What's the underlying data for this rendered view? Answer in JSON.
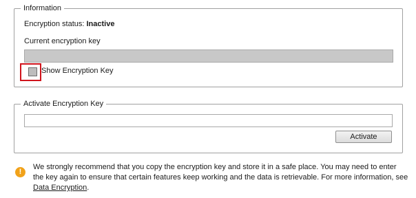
{
  "information": {
    "legend": "Information",
    "status_label": "Encryption status:",
    "status_value": "Inactive",
    "key_label": "Current encryption key",
    "key_value": "",
    "show_key_label": "Show Encryption Key",
    "show_key_checked": false
  },
  "activate": {
    "legend": "Activate Encryption Key",
    "input_value": "",
    "button_label": "Activate"
  },
  "notice": {
    "icon": "warning-icon",
    "text": "We strongly recommend that you copy the encryption key and store it in a safe place. You may need to enter the key again to ensure that certain features keep working and the data is retrievable. For more information, see ",
    "link_text": "Data Encryption",
    "suffix": "."
  },
  "colors": {
    "highlight": "#d0141c",
    "warning": "#f1a21a"
  }
}
